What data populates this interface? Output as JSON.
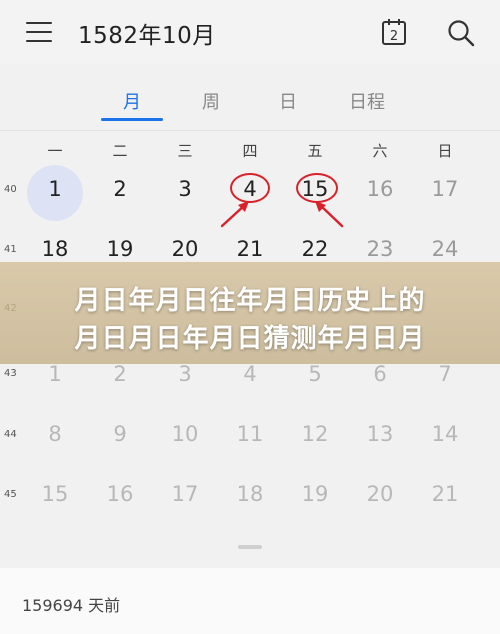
{
  "header": {
    "title": "1582年10月",
    "calendar_icon_day": "2"
  },
  "tabs": [
    {
      "label": "月",
      "active": true
    },
    {
      "label": "周",
      "active": false
    },
    {
      "label": "日",
      "active": false
    },
    {
      "label": "日程",
      "active": false
    }
  ],
  "weekdays": [
    "一",
    "二",
    "三",
    "四",
    "五",
    "六",
    "日"
  ],
  "weeks": [
    {
      "number": "40",
      "days": [
        "1",
        "2",
        "3",
        "4",
        "15",
        "16",
        "17"
      ]
    },
    {
      "number": "41",
      "days": [
        "18",
        "19",
        "20",
        "21",
        "22",
        "23",
        "24"
      ]
    },
    {
      "number": "42",
      "days": [
        "",
        "",
        "",
        "",
        "",
        "",
        ""
      ]
    },
    {
      "number": "43",
      "days": [
        "1",
        "2",
        "3",
        "4",
        "5",
        "6",
        "7"
      ]
    },
    {
      "number": "44",
      "days": [
        "8",
        "9",
        "10",
        "11",
        "12",
        "13",
        "14"
      ]
    },
    {
      "number": "45",
      "days": [
        "15",
        "16",
        "17",
        "18",
        "19",
        "20",
        "21"
      ]
    }
  ],
  "banner": {
    "line1": "月日年月日往年月日历史上的",
    "line2": "月日月日年月日猜测年月日月"
  },
  "footer": {
    "text": "159694 天前"
  },
  "colors": {
    "accent": "#1a73e8",
    "annotation": "#d9212a",
    "today_bg": "#dde3f5"
  }
}
